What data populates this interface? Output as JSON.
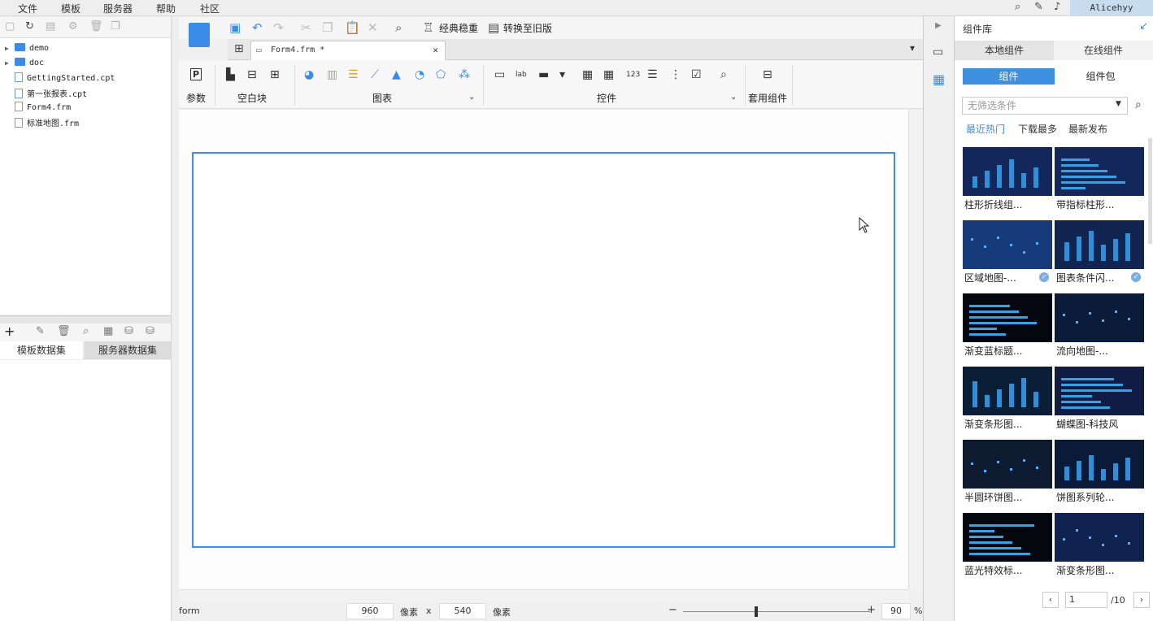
{
  "menu": {
    "items": [
      "文件",
      "模板",
      "服务器",
      "帮助",
      "社区"
    ],
    "user": "Alicehyy"
  },
  "tree": {
    "items": [
      {
        "label": "demo",
        "type": "folder"
      },
      {
        "label": "doc",
        "type": "folder"
      },
      {
        "label": "GettingStarted.cpt",
        "type": "cpt"
      },
      {
        "label": "第一张报表.cpt",
        "type": "cpt"
      },
      {
        "label": "Form4.frm",
        "type": "frm"
      },
      {
        "label": "标准地图.frm",
        "type": "frm"
      }
    ]
  },
  "dataset_tabs": [
    "模板数据集",
    "服务器数据集"
  ],
  "toolbar": {
    "classic_label": "经典稳重",
    "convert_label": "转换至旧版"
  },
  "doc_tab": {
    "title": "Form4.frm *"
  },
  "ribbon": {
    "groups": [
      "参数",
      "空白块",
      "图表",
      "控件",
      "套用组件"
    ]
  },
  "status": {
    "mode": "form",
    "width": "960",
    "unit1": "像素",
    "times": "x",
    "height": "540",
    "unit2": "像素",
    "zoom": "90",
    "percent": "%"
  },
  "right_panel": {
    "title": "组件库",
    "tabs": [
      "本地组件",
      "在线组件"
    ],
    "segments": [
      "组件",
      "组件包"
    ],
    "filter_placeholder": "无筛选条件",
    "sorts": [
      "最近热门",
      "下载最多",
      "最新发布"
    ],
    "cards": [
      {
        "label": "柱形折线组...",
        "checked": false
      },
      {
        "label": "带指标柱形...",
        "checked": false
      },
      {
        "label": "区域地图-...",
        "checked": true
      },
      {
        "label": "图表条件闪...",
        "checked": true
      },
      {
        "label": "渐变蓝标题...",
        "checked": false
      },
      {
        "label": "流向地图-...",
        "checked": false
      },
      {
        "label": "渐变条形图...",
        "checked": false
      },
      {
        "label": "蝴蝶图-科技风",
        "checked": false
      },
      {
        "label": "半圆环饼图...",
        "checked": false
      },
      {
        "label": "饼图系列轮...",
        "checked": false
      },
      {
        "label": "蓝光特效标...",
        "checked": false
      },
      {
        "label": "渐变条形图...",
        "checked": false
      }
    ],
    "page": "1",
    "total_pages": "/10"
  },
  "colors": {
    "accent": "#3d8fe0",
    "thumb_bg": "#0c1a3a"
  }
}
